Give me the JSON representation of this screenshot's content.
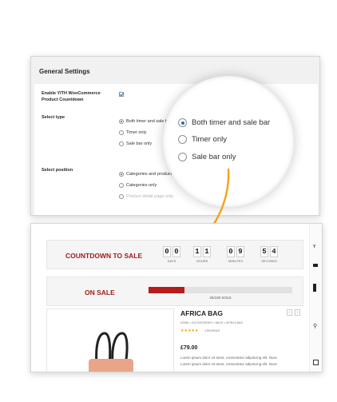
{
  "settings": {
    "title": "General Settings",
    "enable_label": "Enable YITH WooCommerce Product Countdown",
    "enable_checked": true,
    "type_label": "Select type",
    "type_options": [
      "Both timer and sale bar",
      "Timer only",
      "Sale bar only"
    ],
    "type_selected": 0,
    "position_label": "Select position",
    "position_options": [
      "Categories and product detail page",
      "Categories only",
      "Product detail page only"
    ],
    "position_selected": 0
  },
  "magnifier": {
    "options": [
      "Both timer and sale bar",
      "Timer only",
      "Sale bar only"
    ],
    "selected": 0
  },
  "countdown": {
    "title": "COUNTDOWN TO SALE",
    "days": [
      "0",
      "0"
    ],
    "hours": [
      "1",
      "1"
    ],
    "minutes": [
      "0",
      "9"
    ],
    "seconds": [
      "5",
      "4"
    ],
    "labels": {
      "days": "DAYS",
      "hours": "HOURS",
      "minutes": "MINUTES",
      "seconds": "SECONDS"
    }
  },
  "sale": {
    "title": "ON SALE",
    "sold_text": "25/100 SOLD",
    "progress": 0.25
  },
  "product": {
    "name": "AFRICA BAG",
    "breadcrumb": "HOME > ACCESSORIES > BAGS > AFRICA BAG",
    "stars": "★★★★★",
    "reviews": "4 REVIEWS",
    "price": "£79.00",
    "desc_line1": "Lorem ipsum dolor sit amet, consectetur adipiscing elit. Nunc",
    "desc_line2": "Lorem ipsum dolor sit amet, consectetur adipiscing elit. Nunc"
  },
  "sidebar": {
    "letter": "Y"
  },
  "colors": {
    "accent": "#2271b1",
    "sale_red": "#a11b1b",
    "arrow": "#f2a31b"
  }
}
